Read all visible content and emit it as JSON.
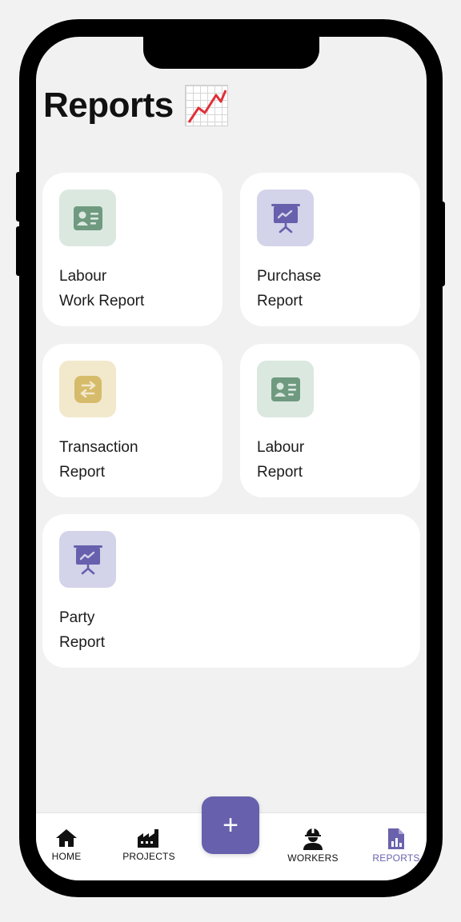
{
  "page": {
    "title": "Reports",
    "title_emoji_icon": "chart-increasing-icon"
  },
  "cards": [
    {
      "line1": "Labour",
      "line2": "Work Report",
      "icon": "id-card-icon",
      "tint": "#dbe8e0",
      "icon_color": "#6f9a80"
    },
    {
      "line1": "Purchase",
      "line2": "Report",
      "icon": "presentation-chart-icon",
      "tint": "#d3d3e9",
      "icon_color": "#6660ad"
    },
    {
      "line1": "Transaction",
      "line2": "Report",
      "icon": "exchange-arrows-icon",
      "tint": "#f2e8cc",
      "icon_color": "#d6bb6a"
    },
    {
      "line1": "Labour",
      "line2": "Report",
      "icon": "id-card-icon",
      "tint": "#dbe8e0",
      "icon_color": "#6f9a80"
    },
    {
      "line1": "Party",
      "line2": "Report",
      "icon": "presentation-chart-icon",
      "tint": "#d3d3e9",
      "icon_color": "#6660ad"
    }
  ],
  "fab": {
    "label": "+",
    "color": "#6660ad"
  },
  "nav": {
    "items": [
      {
        "label": "HOME",
        "icon": "home-icon"
      },
      {
        "label": "PROJECTS",
        "icon": "factory-icon"
      },
      {
        "label": "WORKERS",
        "icon": "worker-icon"
      },
      {
        "label": "REPORTS",
        "icon": "report-chart-icon",
        "active": true
      }
    ],
    "active_color": "#6a62ad"
  }
}
